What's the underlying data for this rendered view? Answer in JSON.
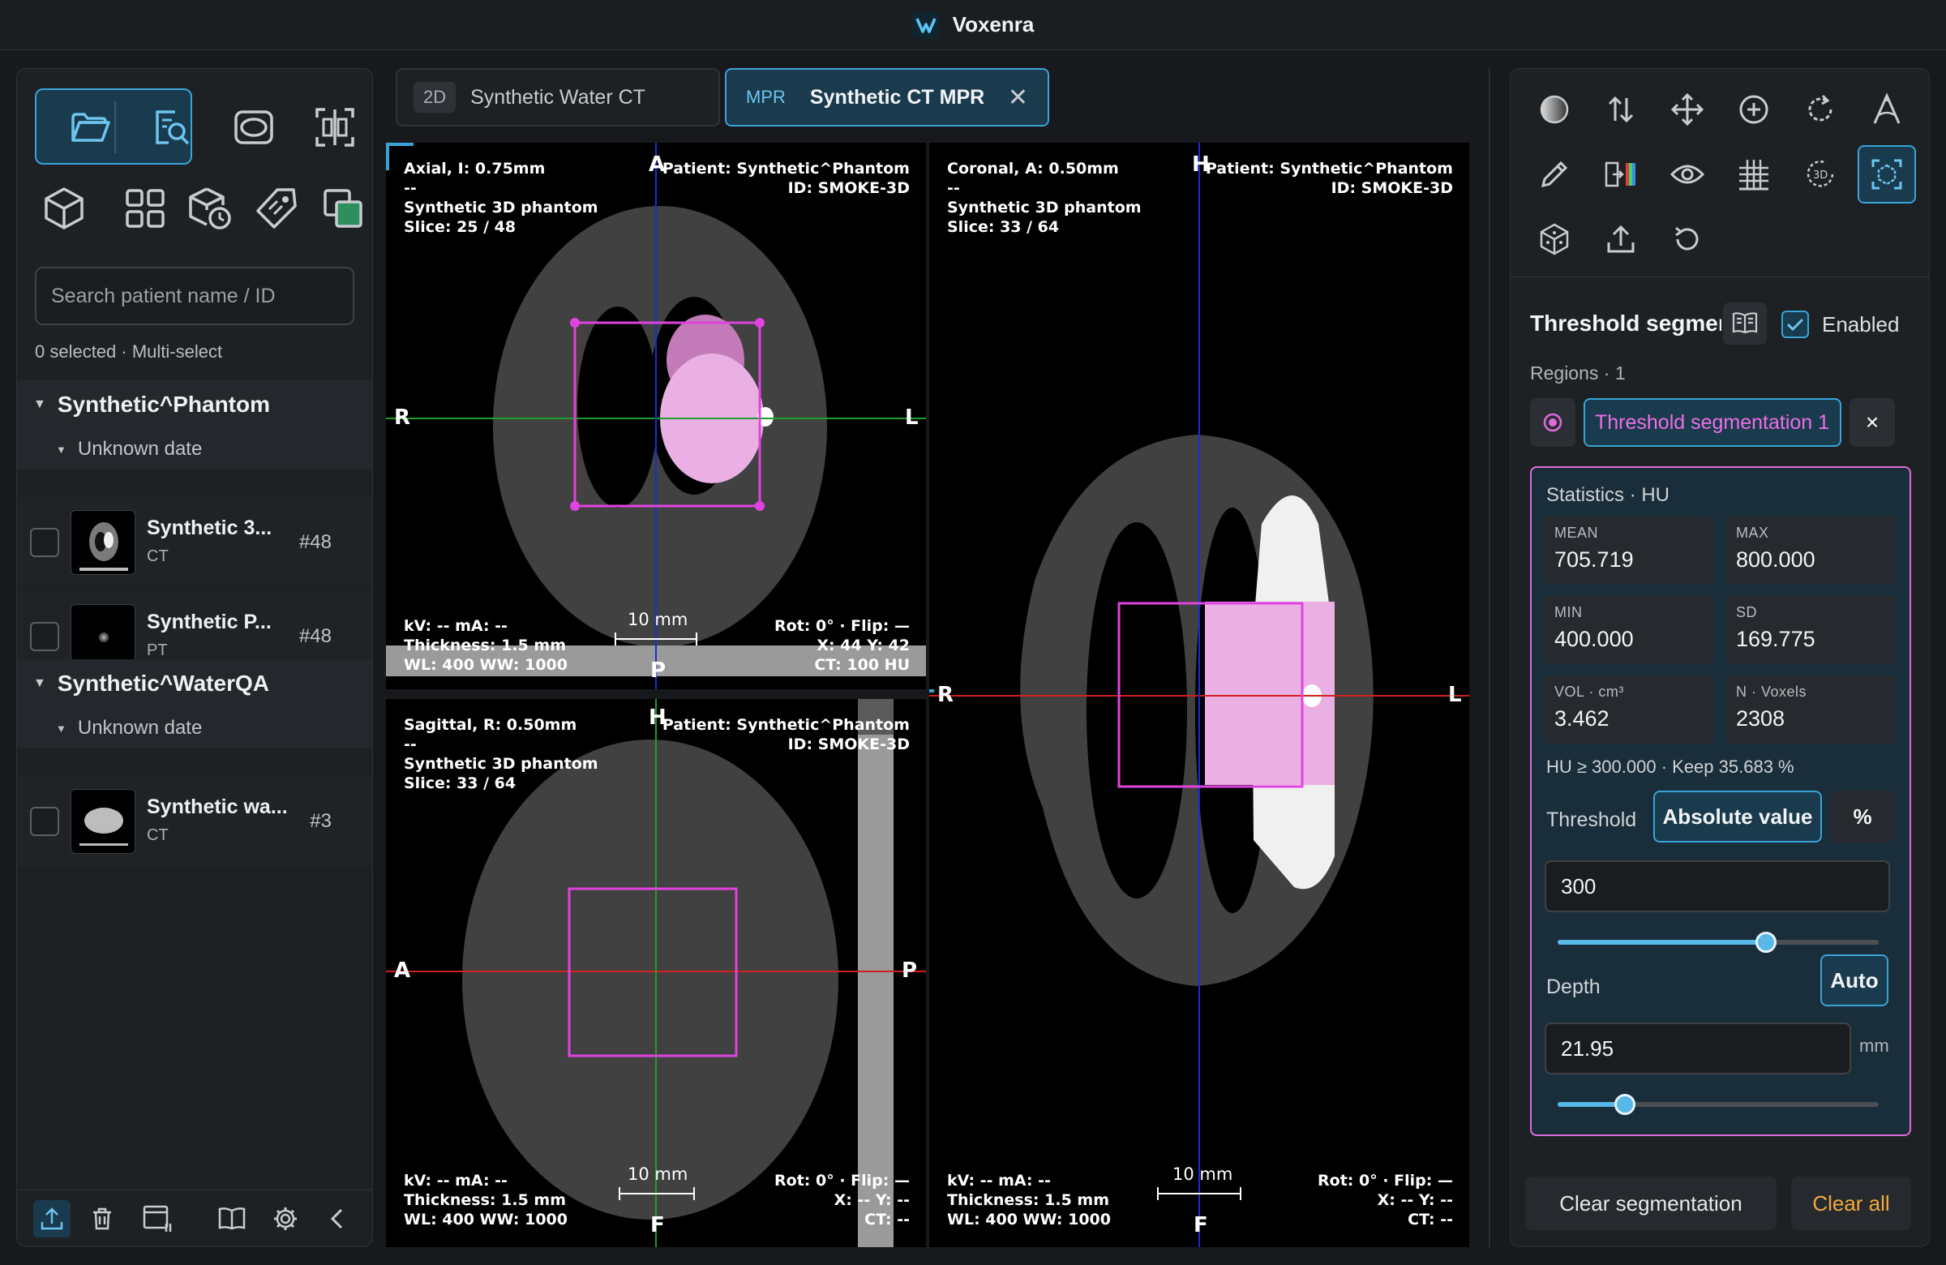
{
  "app": {
    "title": "Voxenra"
  },
  "left": {
    "search_placeholder": "Search patient name / ID",
    "selection_info": "0 selected · Multi-select",
    "patients": [
      {
        "name": "Synthetic^Phantom",
        "date": "Unknown date",
        "series": [
          {
            "name": "Synthetic 3...",
            "modality": "CT",
            "count": "#48"
          },
          {
            "name": "Synthetic P...",
            "modality": "PT",
            "count": "#48"
          }
        ]
      },
      {
        "name": "Synthetic^WaterQA",
        "date": "Unknown date",
        "series": [
          {
            "name": "Synthetic wa...",
            "modality": "CT",
            "count": "#3"
          }
        ]
      }
    ]
  },
  "tabs": [
    {
      "badge": "2D",
      "label": "Synthetic Water CT"
    },
    {
      "badge": "MPR",
      "label": "Synthetic CT MPR",
      "close": "✕"
    }
  ],
  "viewports": {
    "axial": {
      "tl": [
        "Axial, I: 0.75mm",
        "--",
        "Synthetic 3D phantom",
        "Slice: 25 / 48"
      ],
      "tr": [
        "Patient: Synthetic^Phantom",
        "ID: SMOKE-3D"
      ],
      "bl": [
        "kV: --   mA: --",
        "Thickness: 1.5 mm",
        "WL: 400   WW: 1000"
      ],
      "br": [
        "Rot: 0° · Flip: —",
        "X: 44   Y: 42",
        "CT: 100 HU"
      ],
      "scale": "10 mm",
      "orient": {
        "top": "A",
        "bottom": "P",
        "left": "R",
        "right": "L"
      }
    },
    "sagittal": {
      "tl": [
        "Sagittal, R: 0.50mm",
        "--",
        "Synthetic 3D phantom",
        "Slice: 33 / 64"
      ],
      "tr": [
        "Patient: Synthetic^Phantom",
        "ID: SMOKE-3D"
      ],
      "bl": [
        "kV: --   mA: --",
        "Thickness: 1.5 mm",
        "WL: 400   WW: 1000"
      ],
      "br": [
        "Rot: 0° · Flip: —",
        "X: --   Y: --",
        "CT: --"
      ],
      "scale": "10 mm",
      "orient": {
        "top": "H",
        "bottom": "F",
        "left": "A",
        "right": "P"
      }
    },
    "coronal": {
      "tl": [
        "Coronal, A: 0.50mm",
        "--",
        "Synthetic 3D phantom",
        "Slice: 33 / 64"
      ],
      "tr": [
        "Patient: Synthetic^Phantom",
        "ID: SMOKE-3D"
      ],
      "bl": [
        "kV: --   mA: --",
        "Thickness: 1.5 mm",
        "WL: 400   WW: 1000"
      ],
      "br": [
        "Rot: 0° · Flip: —",
        "X: --   Y: --",
        "CT: --"
      ],
      "scale": "10 mm",
      "orient": {
        "top": "H",
        "bottom": "F",
        "left": "R",
        "right": "L"
      }
    }
  },
  "seg": {
    "title": "Threshold segmentation",
    "enabled_label": "Enabled",
    "regions_label": "Regions · 1",
    "region_name": "Threshold segmentation 1",
    "region_close": "×",
    "stats_title": "Statistics · HU",
    "stats": [
      {
        "key": "MEAN",
        "value": "705.719"
      },
      {
        "key": "MAX",
        "value": "800.000"
      },
      {
        "key": "MIN",
        "value": "400.000"
      },
      {
        "key": "SD",
        "value": "169.775"
      },
      {
        "key": "VOL · cm³",
        "value": "3.462"
      },
      {
        "key": "N · Voxels",
        "value": "2308"
      }
    ],
    "hu_line": "HU ≥ 300.000 · Keep 35.683 %",
    "threshold_label": "Threshold",
    "abs_label": "Absolute value",
    "pct_label": "%",
    "threshold_value": "300",
    "threshold_slider": 0.65,
    "depth_label": "Depth",
    "auto_label": "Auto",
    "depth_value": "21.95",
    "depth_unit": "mm",
    "depth_slider": 0.21,
    "clear_seg": "Clear segmentation",
    "clear_all": "Clear all"
  },
  "colors": {
    "accent": "#3aa3d8",
    "seg": "#e06ad9",
    "warn": "#f2a93b"
  }
}
